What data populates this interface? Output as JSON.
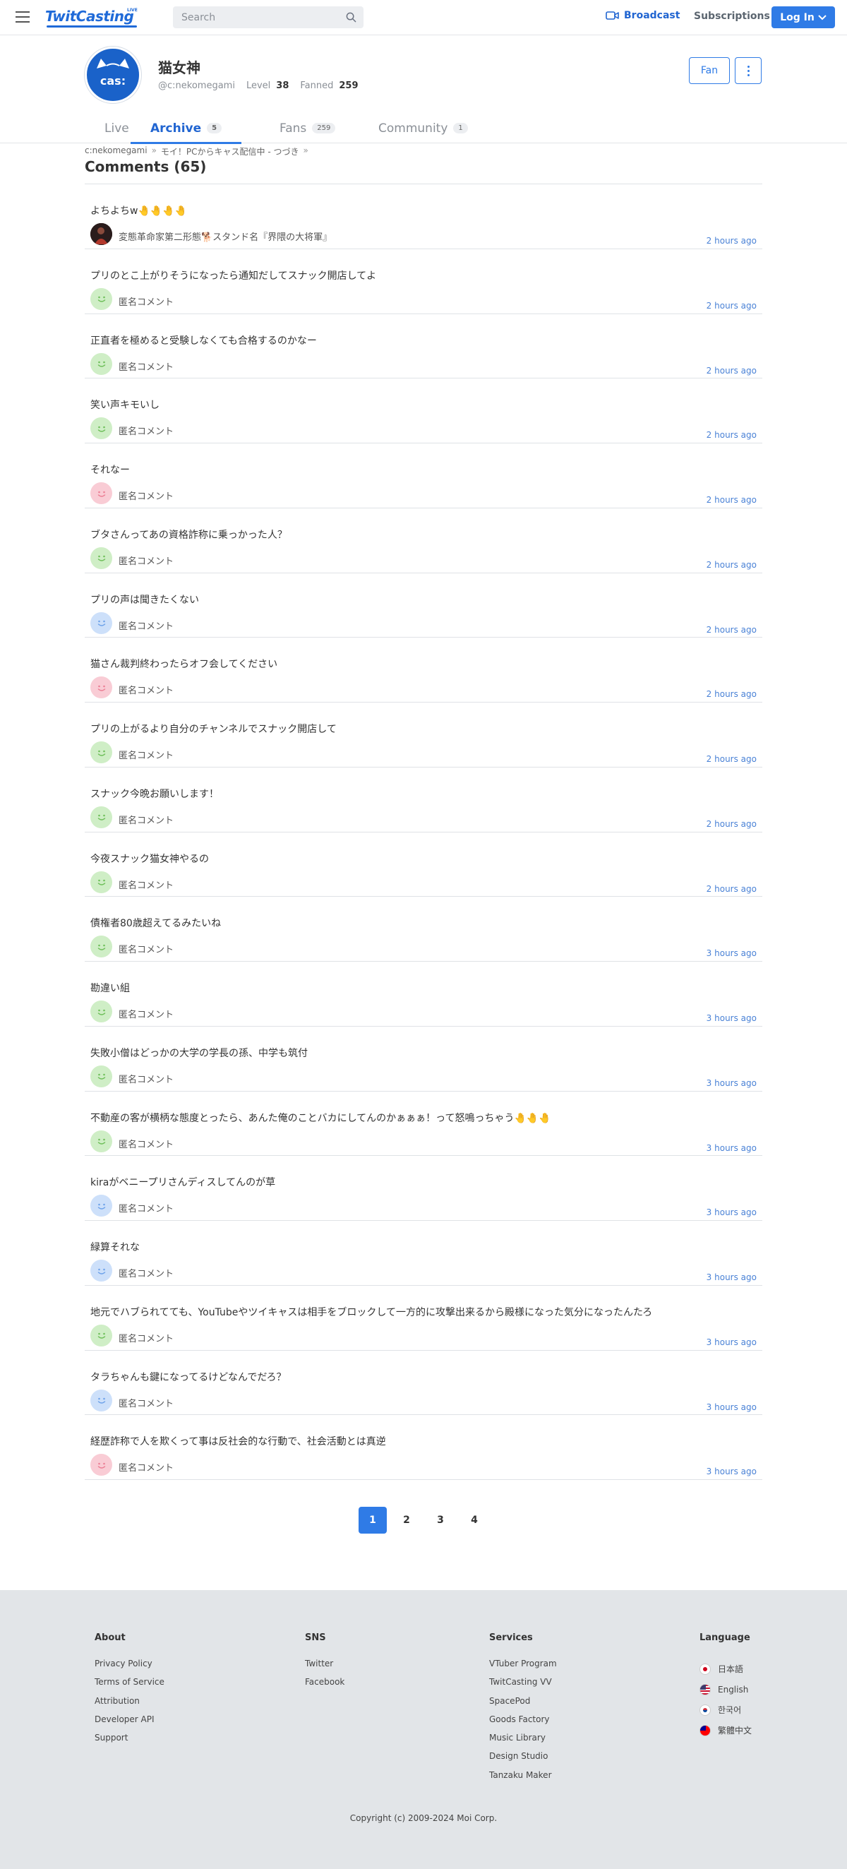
{
  "header": {
    "logo_text": "TwitCasting",
    "logo_badge": "LIVE",
    "search_placeholder": "Search",
    "broadcast_label": "Broadcast",
    "subscriptions_label": "Subscriptions",
    "login_label": "Log In"
  },
  "profile": {
    "avatar_text": "cas:",
    "name": "猫女神",
    "handle": "@c:nekomegami",
    "level_label": "Level",
    "level_value": "38",
    "fanned_label": "Fanned",
    "fanned_value": "259",
    "fan_button": "Fan"
  },
  "tabs": [
    {
      "label": "Live",
      "count": ""
    },
    {
      "label": "Archive",
      "count": "5"
    },
    {
      "label": "Fans",
      "count": "259"
    },
    {
      "label": "Community",
      "count": "1"
    }
  ],
  "breadcrumb": {
    "user": "c:nekomegami",
    "sep": "»",
    "movie": "モイ！PCからキャス配信中 - つづき",
    "sep2": "»"
  },
  "section_title": "Comments (65)",
  "comments": [
    {
      "text": "よちよちw🤚🤚🤚🤚",
      "name": "変態革命家第二形態🐕スタンド名『界隈の大将軍』",
      "time": "2 hours ago",
      "avatar": "photo"
    },
    {
      "text": "プリのとこ上がりそうになったら通知だしてスナック開店してよ",
      "name": "匿名コメント",
      "time": "2 hours ago",
      "avatar": "green"
    },
    {
      "text": "正直者を極めると受験しなくても合格するのかなー",
      "name": "匿名コメント",
      "time": "2 hours ago",
      "avatar": "green"
    },
    {
      "text": "笑い声キモいし",
      "name": "匿名コメント",
      "time": "2 hours ago",
      "avatar": "green"
    },
    {
      "text": "それなー",
      "name": "匿名コメント",
      "time": "2 hours ago",
      "avatar": "pink"
    },
    {
      "text": "ブタさんってあの資格詐称に乗っかった人？",
      "name": "匿名コメント",
      "time": "2 hours ago",
      "avatar": "green"
    },
    {
      "text": "プリの声は聞きたくない",
      "name": "匿名コメント",
      "time": "2 hours ago",
      "avatar": "blue"
    },
    {
      "text": "猫さん裁判終わったらオフ会してください",
      "name": "匿名コメント",
      "time": "2 hours ago",
      "avatar": "pink"
    },
    {
      "text": "プリの上がるより自分のチャンネルでスナック開店して",
      "name": "匿名コメント",
      "time": "2 hours ago",
      "avatar": "green"
    },
    {
      "text": "スナック今晩お願いします！",
      "name": "匿名コメント",
      "time": "2 hours ago",
      "avatar": "green"
    },
    {
      "text": "今夜スナック猫女神やるの",
      "name": "匿名コメント",
      "time": "2 hours ago",
      "avatar": "green"
    },
    {
      "text": "債権者80歳超えてるみたいね",
      "name": "匿名コメント",
      "time": "3 hours ago",
      "avatar": "green"
    },
    {
      "text": "勘違い組",
      "name": "匿名コメント",
      "time": "3 hours ago",
      "avatar": "green"
    },
    {
      "text": "失敗小僧はどっかの大学の学長の孫、中学も筑付",
      "name": "匿名コメント",
      "time": "3 hours ago",
      "avatar": "green"
    },
    {
      "text": "不動産の客が横柄な態度とったら、あんた俺のことバカにしてんのかぁぁぁ！って怒鳴っちゃう🤚🤚🤚",
      "name": "匿名コメント",
      "time": "3 hours ago",
      "avatar": "green"
    },
    {
      "text": "kiraがベニープリさんディスしてんのが草",
      "name": "匿名コメント",
      "time": "3 hours ago",
      "avatar": "blue"
    },
    {
      "text": "緑算それな",
      "name": "匿名コメント",
      "time": "3 hours ago",
      "avatar": "blue"
    },
    {
      "text": "地元でハブられてても、YouTubeやツイキャスは相手をブロックして一方的に攻撃出来るから殿様になった気分になったんたろ",
      "name": "匿名コメント",
      "time": "3 hours ago",
      "avatar": "green"
    },
    {
      "text": "タラちゃんも鍵になってるけどなんでだろ？",
      "name": "匿名コメント",
      "time": "3 hours ago",
      "avatar": "blue"
    },
    {
      "text": "経歴詐称で人を欺くって事は反社会的な行動で、社会活動とは真逆",
      "name": "匿名コメント",
      "time": "3 hours ago",
      "avatar": "pink"
    }
  ],
  "pagination": [
    "1",
    "2",
    "3",
    "4"
  ],
  "footer": {
    "about": {
      "title": "About",
      "links": [
        "Privacy Policy",
        "Terms of Service",
        "Attribution",
        "Developer API",
        "Support"
      ]
    },
    "sns": {
      "title": "SNS",
      "links": [
        "Twitter",
        "Facebook"
      ]
    },
    "services": {
      "title": "Services",
      "links": [
        "VTuber Program",
        "TwitCasting VV",
        "SpacePod",
        "Goods Factory",
        "Music Library",
        "Design Studio",
        "Tanzaku Maker"
      ]
    },
    "language": {
      "title": "Language",
      "items": [
        "日本語",
        "English",
        "한국어",
        "繁體中文"
      ]
    },
    "copyright": "Copyright (c) 2009-2024 Moi Corp."
  },
  "colors": {
    "accent": "#2f7be6",
    "link": "#2165d1",
    "footer_bg": "#e2e5e8"
  }
}
